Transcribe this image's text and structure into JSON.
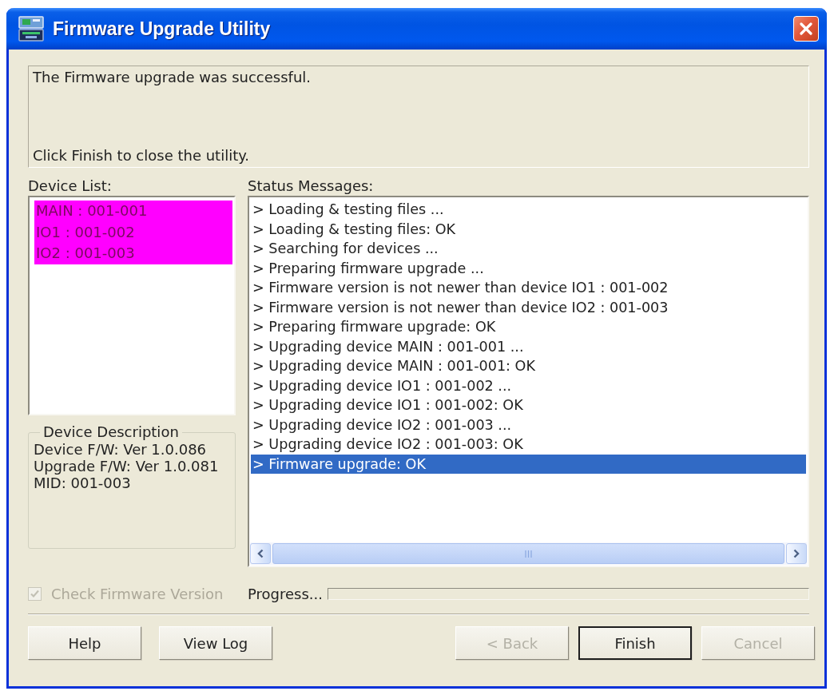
{
  "window": {
    "title": "Firmware Upgrade Utility"
  },
  "message": [
    "The Firmware upgrade was successful.",
    "Click Finish to close the utility."
  ],
  "device_list": {
    "label": "Device List:",
    "items": [
      {
        "text": "MAIN : 001-001",
        "selected": true
      },
      {
        "text": "IO1 : 001-002",
        "selected": true
      },
      {
        "text": "IO2 : 001-003",
        "selected": true
      }
    ]
  },
  "device_description": {
    "title": "Device Description",
    "lines": [
      "Device F/W: Ver 1.0.086",
      "Upgrade F/W: Ver 1.0.081",
      "MID: 001-003"
    ]
  },
  "status_messages": {
    "label": "Status Messages:",
    "items": [
      {
        "text": "> Loading & testing files ...",
        "selected": false
      },
      {
        "text": "> Loading & testing files: OK",
        "selected": false
      },
      {
        "text": "> Searching for devices ...",
        "selected": false
      },
      {
        "text": "> Preparing firmware upgrade ...",
        "selected": false
      },
      {
        "text": "> Firmware version is not newer than device IO1 : 001-002",
        "selected": false
      },
      {
        "text": "> Firmware version is not newer than device IO2 : 001-003",
        "selected": false
      },
      {
        "text": "> Preparing firmware upgrade: OK",
        "selected": false
      },
      {
        "text": "> Upgrading device MAIN : 001-001 ...",
        "selected": false
      },
      {
        "text": "> Upgrading device MAIN : 001-001: OK",
        "selected": false
      },
      {
        "text": "> Upgrading device IO1 : 001-002 ...",
        "selected": false
      },
      {
        "text": "> Upgrading device IO1 : 001-002: OK",
        "selected": false
      },
      {
        "text": "> Upgrading device IO2 : 001-003 ...",
        "selected": false
      },
      {
        "text": "> Upgrading device IO2 : 001-003: OK",
        "selected": false
      },
      {
        "text": "> Firmware upgrade: OK",
        "selected": true
      }
    ]
  },
  "check_firmware": {
    "label": "Check Firmware Version",
    "checked": true,
    "disabled": true
  },
  "progress": {
    "label": "Progress...",
    "level": 0
  },
  "buttons_left": [
    {
      "label": "Help",
      "disabled": false,
      "default": false
    },
    {
      "label": "View Log",
      "disabled": false,
      "default": false
    }
  ],
  "buttons_right": [
    {
      "label": "< Back",
      "disabled": true,
      "default": false
    },
    {
      "label": "Finish",
      "disabled": false,
      "default": true
    },
    {
      "label": "Cancel",
      "disabled": true,
      "default": false
    }
  ]
}
